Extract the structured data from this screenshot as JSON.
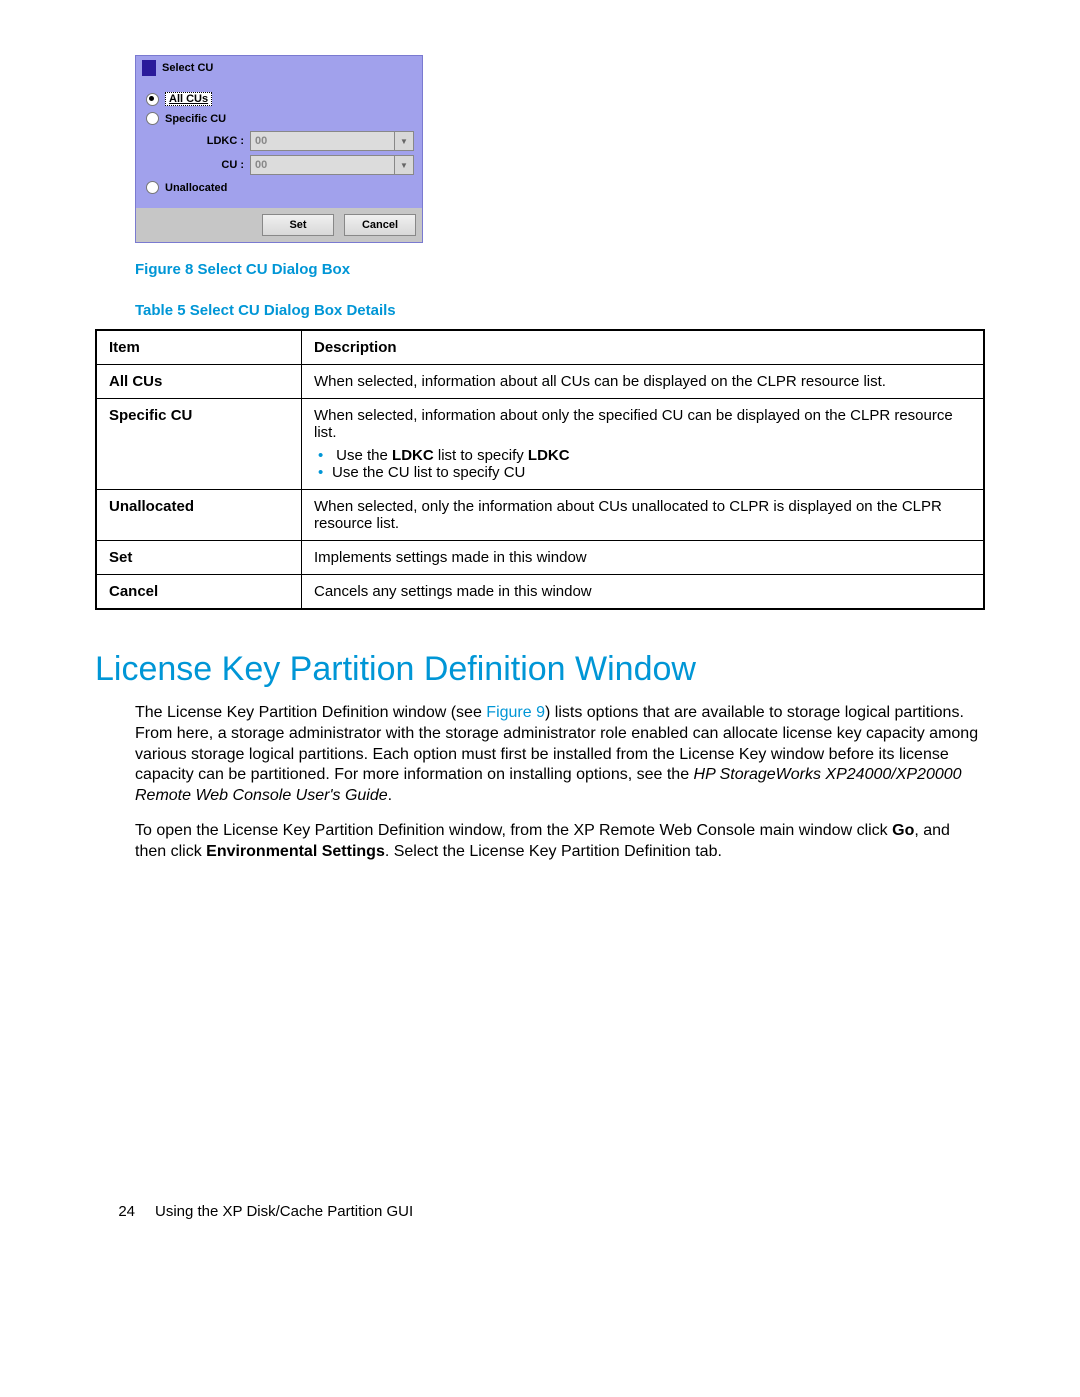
{
  "dialog": {
    "title": "Select CU",
    "radios": {
      "all": "All CUs",
      "specific": "Specific CU",
      "unallocated": "Unallocated"
    },
    "fields": {
      "ldkc_label": "LDKC :",
      "ldkc_value": "00",
      "cu_label": "CU :",
      "cu_value": "00"
    },
    "buttons": {
      "set": "Set",
      "cancel": "Cancel"
    }
  },
  "captions": {
    "figure": "Figure 8 Select CU Dialog Box",
    "table": "Table 5 Select CU Dialog Box Details"
  },
  "table": {
    "headers": {
      "item": "Item",
      "desc": "Description"
    },
    "rows": [
      {
        "item": "All CUs",
        "desc": "When selected, information about all CUs can be displayed on the CLPR resource list."
      },
      {
        "item": "Specific CU",
        "desc": "When selected, information about only the specified CU can be displayed on the CLPR resource list.",
        "bullets_ldkc_pre": "Use the ",
        "bullets_ldkc_b1": "LDKC",
        "bullets_ldkc_mid": " list to specify ",
        "bullets_ldkc_b2": "LDKC",
        "bullets_cu": "Use the CU list to specify CU"
      },
      {
        "item": "Unallocated",
        "desc": "When selected, only the information about CUs unallocated to CLPR is displayed on the CLPR resource list."
      },
      {
        "item": "Set",
        "desc": "Implements settings made in this window"
      },
      {
        "item": "Cancel",
        "desc": "Cancels any settings made in this window"
      }
    ]
  },
  "section": {
    "heading": "License Key Partition Definition Window",
    "p1_a": "The License Key Partition Definition window (see ",
    "p1_link": "Figure 9",
    "p1_b": ") lists options that are available to storage logical partitions. From here, a storage administrator with the storage administrator role enabled can allocate license key capacity among various storage logical partitions. Each option must first be installed from the License Key window before its license capacity can be partitioned. For more information on installing options, see the ",
    "p1_italic": "HP StorageWorks XP24000/XP20000 Remote Web Console User's Guide",
    "p1_c": ".",
    "p2_a": "To open the License Key Partition Definition window, from the XP Remote Web Console main window click ",
    "p2_b1": "Go",
    "p2_b": ", and then click ",
    "p2_b2": "Environmental Settings",
    "p2_c": ". Select the License Key Partition Definition tab."
  },
  "footer": {
    "page": "24",
    "text": "Using the XP Disk/Cache Partition GUI"
  }
}
